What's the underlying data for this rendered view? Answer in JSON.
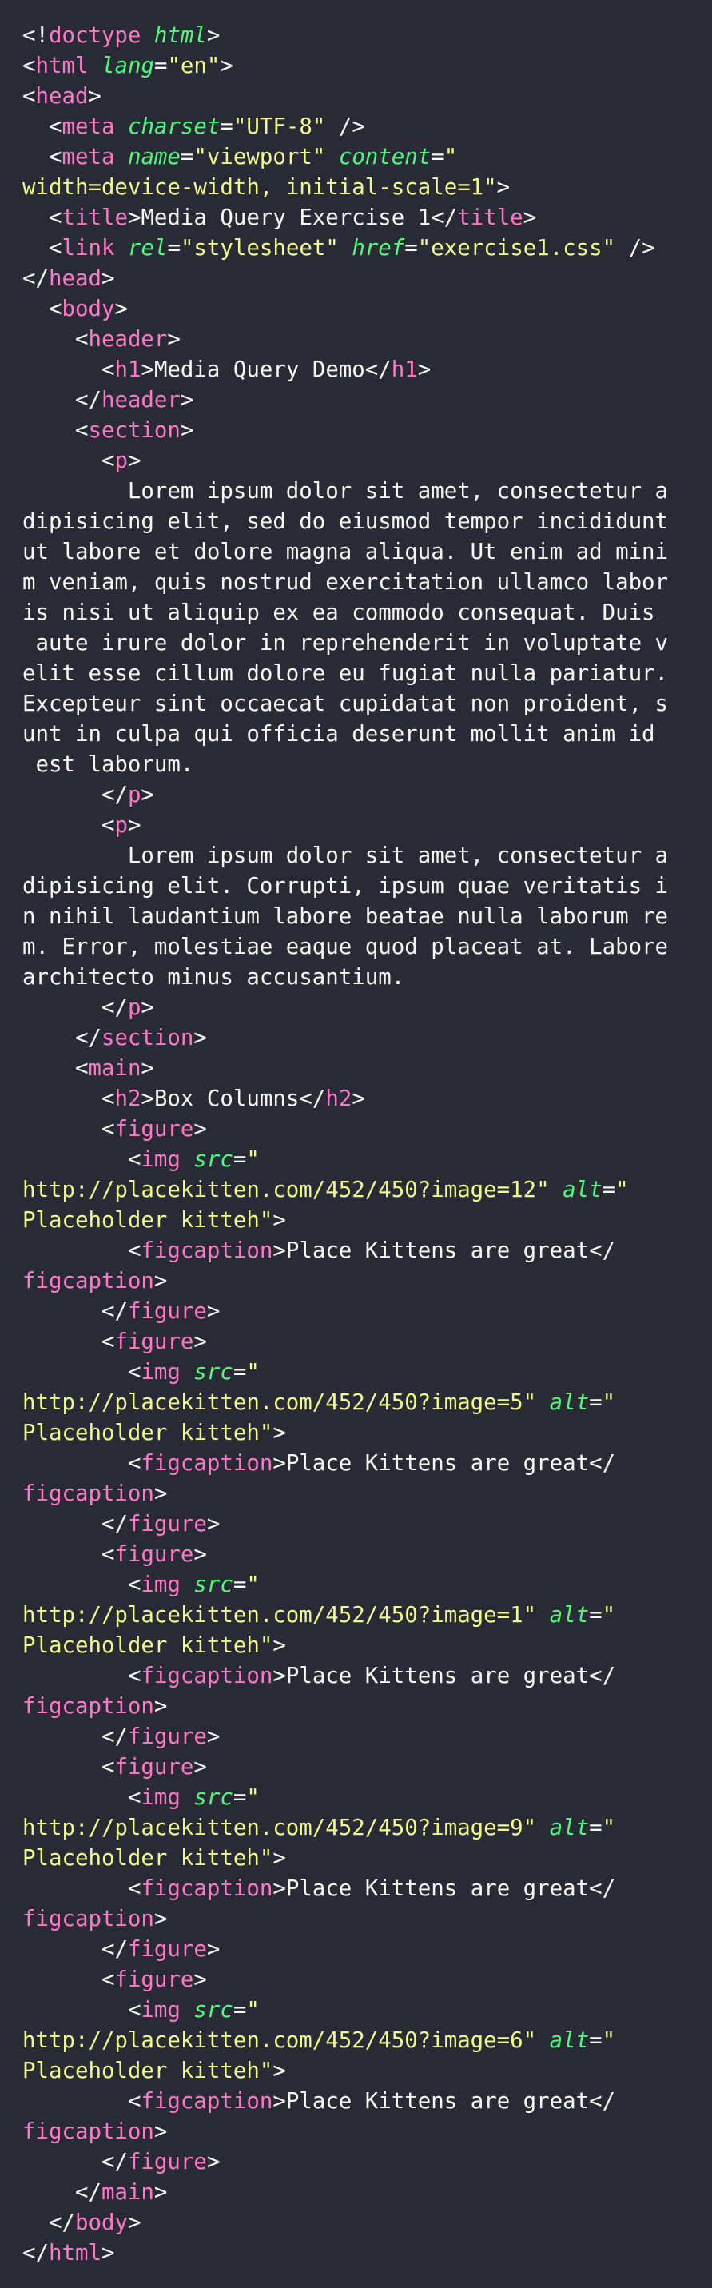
{
  "theme": {
    "background": "#282a36",
    "text": "#f8f8f2",
    "tag": "#ff79c6",
    "attribute": "#50fa7b",
    "string": "#f1fa8c"
  },
  "lines": [
    [
      [
        "punct",
        "<!"
      ],
      [
        "tag",
        "doctype"
      ],
      [
        "plain",
        " "
      ],
      [
        "attr",
        "html"
      ],
      [
        "punct",
        ">"
      ]
    ],
    [
      [
        "punct",
        "<"
      ],
      [
        "tag",
        "html"
      ],
      [
        "plain",
        " "
      ],
      [
        "attr",
        "lang"
      ],
      [
        "punct",
        "="
      ],
      [
        "str",
        "\"en\""
      ],
      [
        "punct",
        ">"
      ]
    ],
    [
      [
        "punct",
        "<"
      ],
      [
        "tag",
        "head"
      ],
      [
        "punct",
        ">"
      ]
    ],
    [
      [
        "plain",
        "  "
      ],
      [
        "punct",
        "<"
      ],
      [
        "tag",
        "meta"
      ],
      [
        "plain",
        " "
      ],
      [
        "attr",
        "charset"
      ],
      [
        "punct",
        "="
      ],
      [
        "str",
        "\"UTF-8\""
      ],
      [
        "plain",
        " "
      ],
      [
        "punct",
        "/>"
      ]
    ],
    [
      [
        "plain",
        "  "
      ],
      [
        "punct",
        "<"
      ],
      [
        "tag",
        "meta"
      ],
      [
        "plain",
        " "
      ],
      [
        "attr",
        "name"
      ],
      [
        "punct",
        "="
      ],
      [
        "str",
        "\"viewport\""
      ],
      [
        "plain",
        " "
      ],
      [
        "attr",
        "content"
      ],
      [
        "punct",
        "="
      ],
      [
        "str",
        "\""
      ]
    ],
    [
      [
        "str",
        "width=device-width, initial-scale=1\""
      ],
      [
        "punct",
        ">"
      ]
    ],
    [
      [
        "plain",
        "  "
      ],
      [
        "punct",
        "<"
      ],
      [
        "tag",
        "title"
      ],
      [
        "punct",
        ">"
      ],
      [
        "text",
        "Media Query Exercise 1"
      ],
      [
        "punct",
        "</"
      ],
      [
        "tag",
        "title"
      ],
      [
        "punct",
        ">"
      ]
    ],
    [
      [
        "plain",
        "  "
      ],
      [
        "punct",
        "<"
      ],
      [
        "tag",
        "link"
      ],
      [
        "plain",
        " "
      ],
      [
        "attr",
        "rel"
      ],
      [
        "punct",
        "="
      ],
      [
        "str",
        "\"stylesheet\""
      ],
      [
        "plain",
        " "
      ],
      [
        "attr",
        "href"
      ],
      [
        "punct",
        "="
      ],
      [
        "str",
        "\"exercise1.css\""
      ],
      [
        "plain",
        " "
      ],
      [
        "punct",
        "/>"
      ]
    ],
    [
      [
        "punct",
        "</"
      ],
      [
        "tag",
        "head"
      ],
      [
        "punct",
        ">"
      ]
    ],
    [
      [
        "plain",
        "  "
      ],
      [
        "punct",
        "<"
      ],
      [
        "tag",
        "body"
      ],
      [
        "punct",
        ">"
      ]
    ],
    [
      [
        "plain",
        "    "
      ],
      [
        "punct",
        "<"
      ],
      [
        "tag",
        "header"
      ],
      [
        "punct",
        ">"
      ]
    ],
    [
      [
        "plain",
        "      "
      ],
      [
        "punct",
        "<"
      ],
      [
        "tag",
        "h1"
      ],
      [
        "punct",
        ">"
      ],
      [
        "text",
        "Media Query Demo"
      ],
      [
        "punct",
        "</"
      ],
      [
        "tag",
        "h1"
      ],
      [
        "punct",
        ">"
      ]
    ],
    [
      [
        "plain",
        "    "
      ],
      [
        "punct",
        "</"
      ],
      [
        "tag",
        "header"
      ],
      [
        "punct",
        ">"
      ]
    ],
    [
      [
        "plain",
        "    "
      ],
      [
        "punct",
        "<"
      ],
      [
        "tag",
        "section"
      ],
      [
        "punct",
        ">"
      ]
    ],
    [
      [
        "plain",
        "      "
      ],
      [
        "punct",
        "<"
      ],
      [
        "tag",
        "p"
      ],
      [
        "punct",
        ">"
      ]
    ],
    [
      [
        "text",
        "        Lorem ipsum dolor sit amet, consectetur a"
      ]
    ],
    [
      [
        "text",
        "dipisicing elit, sed do eiusmod tempor incididunt"
      ]
    ],
    [
      [
        "text",
        "ut labore et dolore magna aliqua. Ut enim ad mini"
      ]
    ],
    [
      [
        "text",
        "m veniam, quis nostrud exercitation ullamco labor"
      ]
    ],
    [
      [
        "text",
        "is nisi ut aliquip ex ea commodo consequat. Duis"
      ]
    ],
    [
      [
        "text",
        " aute irure dolor in reprehenderit in voluptate v"
      ]
    ],
    [
      [
        "text",
        "elit esse cillum dolore eu fugiat nulla pariatur."
      ]
    ],
    [
      [
        "text",
        "Excepteur sint occaecat cupidatat non proident, s"
      ]
    ],
    [
      [
        "text",
        "unt in culpa qui officia deserunt mollit anim id"
      ]
    ],
    [
      [
        "text",
        " est laborum."
      ]
    ],
    [
      [
        "plain",
        "      "
      ],
      [
        "punct",
        "</"
      ],
      [
        "tag",
        "p"
      ],
      [
        "punct",
        ">"
      ]
    ],
    [
      [
        "plain",
        "      "
      ],
      [
        "punct",
        "<"
      ],
      [
        "tag",
        "p"
      ],
      [
        "punct",
        ">"
      ]
    ],
    [
      [
        "text",
        "        Lorem ipsum dolor sit amet, consectetur a"
      ]
    ],
    [
      [
        "text",
        "dipisicing elit. Corrupti, ipsum quae veritatis i"
      ]
    ],
    [
      [
        "text",
        "n nihil laudantium labore beatae nulla laborum re"
      ]
    ],
    [
      [
        "text",
        "m. Error, molestiae eaque quod placeat at. Labore"
      ]
    ],
    [
      [
        "text",
        "architecto minus accusantium."
      ]
    ],
    [
      [
        "plain",
        "      "
      ],
      [
        "punct",
        "</"
      ],
      [
        "tag",
        "p"
      ],
      [
        "punct",
        ">"
      ]
    ],
    [
      [
        "plain",
        "    "
      ],
      [
        "punct",
        "</"
      ],
      [
        "tag",
        "section"
      ],
      [
        "punct",
        ">"
      ]
    ],
    [
      [
        "plain",
        "    "
      ],
      [
        "punct",
        "<"
      ],
      [
        "tag",
        "main"
      ],
      [
        "punct",
        ">"
      ]
    ],
    [
      [
        "plain",
        "      "
      ],
      [
        "punct",
        "<"
      ],
      [
        "tag",
        "h2"
      ],
      [
        "punct",
        ">"
      ],
      [
        "text",
        "Box Columns"
      ],
      [
        "punct",
        "</"
      ],
      [
        "tag",
        "h2"
      ],
      [
        "punct",
        ">"
      ]
    ],
    [
      [
        "plain",
        "      "
      ],
      [
        "punct",
        "<"
      ],
      [
        "tag",
        "figure"
      ],
      [
        "punct",
        ">"
      ]
    ],
    [
      [
        "plain",
        "        "
      ],
      [
        "punct",
        "<"
      ],
      [
        "tag",
        "img"
      ],
      [
        "plain",
        " "
      ],
      [
        "attr",
        "src"
      ],
      [
        "punct",
        "="
      ],
      [
        "str",
        "\""
      ]
    ],
    [
      [
        "str",
        "http://placekitten.com/452/450?image=12\""
      ],
      [
        "plain",
        " "
      ],
      [
        "attr",
        "alt"
      ],
      [
        "punct",
        "="
      ],
      [
        "str",
        "\""
      ]
    ],
    [
      [
        "str",
        "Placeholder kitteh\""
      ],
      [
        "punct",
        ">"
      ]
    ],
    [
      [
        "plain",
        "        "
      ],
      [
        "punct",
        "<"
      ],
      [
        "tag",
        "figcaption"
      ],
      [
        "punct",
        ">"
      ],
      [
        "text",
        "Place Kittens are great"
      ],
      [
        "punct",
        "</"
      ]
    ],
    [
      [
        "tag",
        "figcaption"
      ],
      [
        "punct",
        ">"
      ]
    ],
    [
      [
        "plain",
        "      "
      ],
      [
        "punct",
        "</"
      ],
      [
        "tag",
        "figure"
      ],
      [
        "punct",
        ">"
      ]
    ],
    [
      [
        "plain",
        "      "
      ],
      [
        "punct",
        "<"
      ],
      [
        "tag",
        "figure"
      ],
      [
        "punct",
        ">"
      ]
    ],
    [
      [
        "plain",
        "        "
      ],
      [
        "punct",
        "<"
      ],
      [
        "tag",
        "img"
      ],
      [
        "plain",
        " "
      ],
      [
        "attr",
        "src"
      ],
      [
        "punct",
        "="
      ],
      [
        "str",
        "\""
      ]
    ],
    [
      [
        "str",
        "http://placekitten.com/452/450?image=5\""
      ],
      [
        "plain",
        " "
      ],
      [
        "attr",
        "alt"
      ],
      [
        "punct",
        "="
      ],
      [
        "str",
        "\""
      ]
    ],
    [
      [
        "str",
        "Placeholder kitteh\""
      ],
      [
        "punct",
        ">"
      ]
    ],
    [
      [
        "plain",
        "        "
      ],
      [
        "punct",
        "<"
      ],
      [
        "tag",
        "figcaption"
      ],
      [
        "punct",
        ">"
      ],
      [
        "text",
        "Place Kittens are great"
      ],
      [
        "punct",
        "</"
      ]
    ],
    [
      [
        "tag",
        "figcaption"
      ],
      [
        "punct",
        ">"
      ]
    ],
    [
      [
        "plain",
        "      "
      ],
      [
        "punct",
        "</"
      ],
      [
        "tag",
        "figure"
      ],
      [
        "punct",
        ">"
      ]
    ],
    [
      [
        "plain",
        "      "
      ],
      [
        "punct",
        "<"
      ],
      [
        "tag",
        "figure"
      ],
      [
        "punct",
        ">"
      ]
    ],
    [
      [
        "plain",
        "        "
      ],
      [
        "punct",
        "<"
      ],
      [
        "tag",
        "img"
      ],
      [
        "plain",
        " "
      ],
      [
        "attr",
        "src"
      ],
      [
        "punct",
        "="
      ],
      [
        "str",
        "\""
      ]
    ],
    [
      [
        "str",
        "http://placekitten.com/452/450?image=1\""
      ],
      [
        "plain",
        " "
      ],
      [
        "attr",
        "alt"
      ],
      [
        "punct",
        "="
      ],
      [
        "str",
        "\""
      ]
    ],
    [
      [
        "str",
        "Placeholder kitteh\""
      ],
      [
        "punct",
        ">"
      ]
    ],
    [
      [
        "plain",
        "        "
      ],
      [
        "punct",
        "<"
      ],
      [
        "tag",
        "figcaption"
      ],
      [
        "punct",
        ">"
      ],
      [
        "text",
        "Place Kittens are great"
      ],
      [
        "punct",
        "</"
      ]
    ],
    [
      [
        "tag",
        "figcaption"
      ],
      [
        "punct",
        ">"
      ]
    ],
    [
      [
        "plain",
        "      "
      ],
      [
        "punct",
        "</"
      ],
      [
        "tag",
        "figure"
      ],
      [
        "punct",
        ">"
      ]
    ],
    [
      [
        "plain",
        "      "
      ],
      [
        "punct",
        "<"
      ],
      [
        "tag",
        "figure"
      ],
      [
        "punct",
        ">"
      ]
    ],
    [
      [
        "plain",
        "        "
      ],
      [
        "punct",
        "<"
      ],
      [
        "tag",
        "img"
      ],
      [
        "plain",
        " "
      ],
      [
        "attr",
        "src"
      ],
      [
        "punct",
        "="
      ],
      [
        "str",
        "\""
      ]
    ],
    [
      [
        "str",
        "http://placekitten.com/452/450?image=9\""
      ],
      [
        "plain",
        " "
      ],
      [
        "attr",
        "alt"
      ],
      [
        "punct",
        "="
      ],
      [
        "str",
        "\""
      ]
    ],
    [
      [
        "str",
        "Placeholder kitteh\""
      ],
      [
        "punct",
        ">"
      ]
    ],
    [
      [
        "plain",
        "        "
      ],
      [
        "punct",
        "<"
      ],
      [
        "tag",
        "figcaption"
      ],
      [
        "punct",
        ">"
      ],
      [
        "text",
        "Place Kittens are great"
      ],
      [
        "punct",
        "</"
      ]
    ],
    [
      [
        "tag",
        "figcaption"
      ],
      [
        "punct",
        ">"
      ]
    ],
    [
      [
        "plain",
        "      "
      ],
      [
        "punct",
        "</"
      ],
      [
        "tag",
        "figure"
      ],
      [
        "punct",
        ">"
      ]
    ],
    [
      [
        "plain",
        "      "
      ],
      [
        "punct",
        "<"
      ],
      [
        "tag",
        "figure"
      ],
      [
        "punct",
        ">"
      ]
    ],
    [
      [
        "plain",
        "        "
      ],
      [
        "punct",
        "<"
      ],
      [
        "tag",
        "img"
      ],
      [
        "plain",
        " "
      ],
      [
        "attr",
        "src"
      ],
      [
        "punct",
        "="
      ],
      [
        "str",
        "\""
      ]
    ],
    [
      [
        "str",
        "http://placekitten.com/452/450?image=6\""
      ],
      [
        "plain",
        " "
      ],
      [
        "attr",
        "alt"
      ],
      [
        "punct",
        "="
      ],
      [
        "str",
        "\""
      ]
    ],
    [
      [
        "str",
        "Placeholder kitteh\""
      ],
      [
        "punct",
        ">"
      ]
    ],
    [
      [
        "plain",
        "        "
      ],
      [
        "punct",
        "<"
      ],
      [
        "tag",
        "figcaption"
      ],
      [
        "punct",
        ">"
      ],
      [
        "text",
        "Place Kittens are great"
      ],
      [
        "punct",
        "</"
      ]
    ],
    [
      [
        "tag",
        "figcaption"
      ],
      [
        "punct",
        ">"
      ]
    ],
    [
      [
        "plain",
        "      "
      ],
      [
        "punct",
        "</"
      ],
      [
        "tag",
        "figure"
      ],
      [
        "punct",
        ">"
      ]
    ],
    [
      [
        "plain",
        "    "
      ],
      [
        "punct",
        "</"
      ],
      [
        "tag",
        "main"
      ],
      [
        "punct",
        ">"
      ]
    ],
    [
      [
        "plain",
        "  "
      ],
      [
        "punct",
        "</"
      ],
      [
        "tag",
        "body"
      ],
      [
        "punct",
        ">"
      ]
    ],
    [
      [
        "punct",
        "</"
      ],
      [
        "tag",
        "html"
      ],
      [
        "punct",
        ">"
      ]
    ]
  ]
}
